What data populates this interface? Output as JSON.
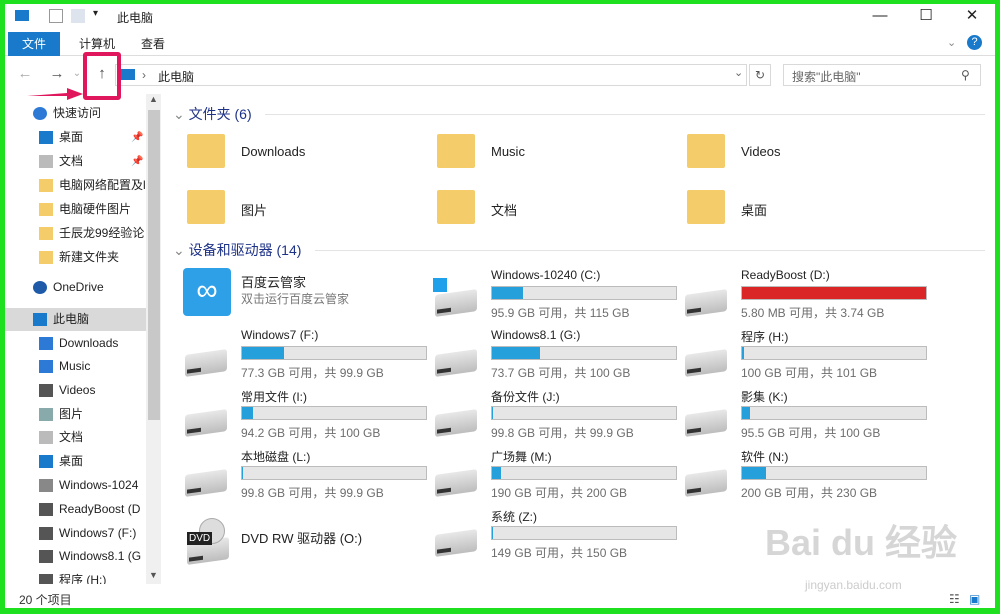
{
  "window": {
    "title": "此电脑",
    "minimize": "—",
    "maximize": "☐",
    "close": "✕"
  },
  "ribbon": {
    "tabs": [
      "文件",
      "计算机",
      "查看"
    ],
    "help": "?"
  },
  "nav": {
    "back": "←",
    "forward": "→",
    "recent": "⌄",
    "up": "↑",
    "breadcrumb": "此电脑",
    "refresh": "↻",
    "dropdown": "⌄",
    "search_placeholder": "搜索\"此电脑\""
  },
  "sidebar": {
    "items": [
      {
        "label": "快速访问",
        "icon": "star",
        "indent": 0,
        "color": "#2d7ad6"
      },
      {
        "label": "桌面",
        "icon": "desktop",
        "indent": 1,
        "pinned": true,
        "color": "#1979ca"
      },
      {
        "label": "文档",
        "icon": "document",
        "indent": 1,
        "pinned": true,
        "color": "#bbb"
      },
      {
        "label": "电脑网络配置及l",
        "icon": "folder",
        "indent": 1,
        "color": "#f4cd6a"
      },
      {
        "label": "电脑硬件图片",
        "icon": "folder",
        "indent": 1,
        "color": "#f4cd6a"
      },
      {
        "label": "壬辰龙99经验论",
        "icon": "folder",
        "indent": 1,
        "color": "#f4cd6a"
      },
      {
        "label": "新建文件夹",
        "icon": "folder",
        "indent": 1,
        "color": "#f4cd6a"
      },
      {
        "label": "OneDrive",
        "icon": "cloud",
        "indent": 0,
        "color": "#1e5aa8"
      },
      {
        "label": "此电脑",
        "icon": "computer",
        "indent": 0,
        "selected": true,
        "color": "#1979ca"
      },
      {
        "label": "Downloads",
        "icon": "download",
        "indent": 1,
        "color": "#2d7ad6"
      },
      {
        "label": "Music",
        "icon": "music",
        "indent": 1,
        "color": "#2d7ad6"
      },
      {
        "label": "Videos",
        "icon": "video",
        "indent": 1,
        "color": "#555"
      },
      {
        "label": "图片",
        "icon": "picture",
        "indent": 1,
        "color": "#8aa"
      },
      {
        "label": "文档",
        "icon": "document",
        "indent": 1,
        "color": "#bbb"
      },
      {
        "label": "桌面",
        "icon": "desktop",
        "indent": 1,
        "color": "#1979ca"
      },
      {
        "label": "Windows-1024",
        "icon": "windows-drive",
        "indent": 1,
        "color": "#888"
      },
      {
        "label": "ReadyBoost (D",
        "icon": "drive",
        "indent": 1,
        "color": "#555"
      },
      {
        "label": "Windows7 (F:)",
        "icon": "drive",
        "indent": 1,
        "color": "#555"
      },
      {
        "label": "Windows8.1 (G",
        "icon": "drive",
        "indent": 1,
        "color": "#555"
      },
      {
        "label": "程序 (H:)",
        "icon": "drive",
        "indent": 1,
        "color": "#555"
      }
    ]
  },
  "folders": {
    "header": "文件夹 (6)",
    "items": [
      {
        "label": "Downloads",
        "icon": "download-folder"
      },
      {
        "label": "Music",
        "icon": "music-folder"
      },
      {
        "label": "Videos",
        "icon": "video-folder"
      },
      {
        "label": "图片",
        "icon": "picture-folder"
      },
      {
        "label": "文档",
        "icon": "document-folder"
      },
      {
        "label": "桌面",
        "icon": "desktop-folder"
      }
    ]
  },
  "devices": {
    "header": "设备和驱动器 (14)",
    "baidu": {
      "name": "百度云管家",
      "subtitle": "双击运行百度云管家"
    },
    "drives": [
      {
        "name": "Windows-10240 (C:)",
        "info": "95.9 GB 可用，共 115 GB",
        "used": 0.166,
        "color": "#26a0da"
      },
      {
        "name": "ReadyBoost (D:)",
        "info": "5.80 MB 可用，共 3.74 GB",
        "used": 1.0,
        "color": "#da2626"
      },
      {
        "name": "Windows7 (F:)",
        "info": "77.3 GB 可用，共 99.9 GB",
        "used": 0.226,
        "color": "#26a0da"
      },
      {
        "name": "Windows8.1 (G:)",
        "info": "73.7 GB 可用，共 100 GB",
        "used": 0.263,
        "color": "#26a0da"
      },
      {
        "name": "程序 (H:)",
        "info": "100 GB 可用，共 101 GB",
        "used": 0.01,
        "color": "#26a0da"
      },
      {
        "name": "常用文件 (I:)",
        "info": "94.2 GB 可用，共 100 GB",
        "used": 0.058,
        "color": "#26a0da"
      },
      {
        "name": "备份文件  (J:)",
        "info": "99.8 GB 可用，共 99.9 GB",
        "used": 0.001,
        "color": "#26a0da"
      },
      {
        "name": "影集 (K:)",
        "info": "95.5 GB 可用，共 100 GB",
        "used": 0.045,
        "color": "#26a0da"
      },
      {
        "name": "本地磁盘 (L:)",
        "info": "99.8 GB 可用，共 99.9 GB",
        "used": 0.001,
        "color": "#26a0da"
      },
      {
        "name": "广场舞 (M:)",
        "info": "190 GB 可用，共 200 GB",
        "used": 0.05,
        "color": "#26a0da"
      },
      {
        "name": "软件 (N:)",
        "info": "200 GB 可用，共 230 GB",
        "used": 0.13,
        "color": "#26a0da"
      },
      {
        "name": "系统 (Z:)",
        "info": "149 GB 可用，共 150 GB",
        "used": 0.007,
        "color": "#26a0da"
      }
    ],
    "dvd": {
      "name": "DVD RW 驱动器 (O:)",
      "badge": "DVD"
    }
  },
  "status": {
    "count": "20 个项目"
  },
  "watermark": {
    "text": "Bai du 经验",
    "url": "jingyan.baidu.com"
  }
}
